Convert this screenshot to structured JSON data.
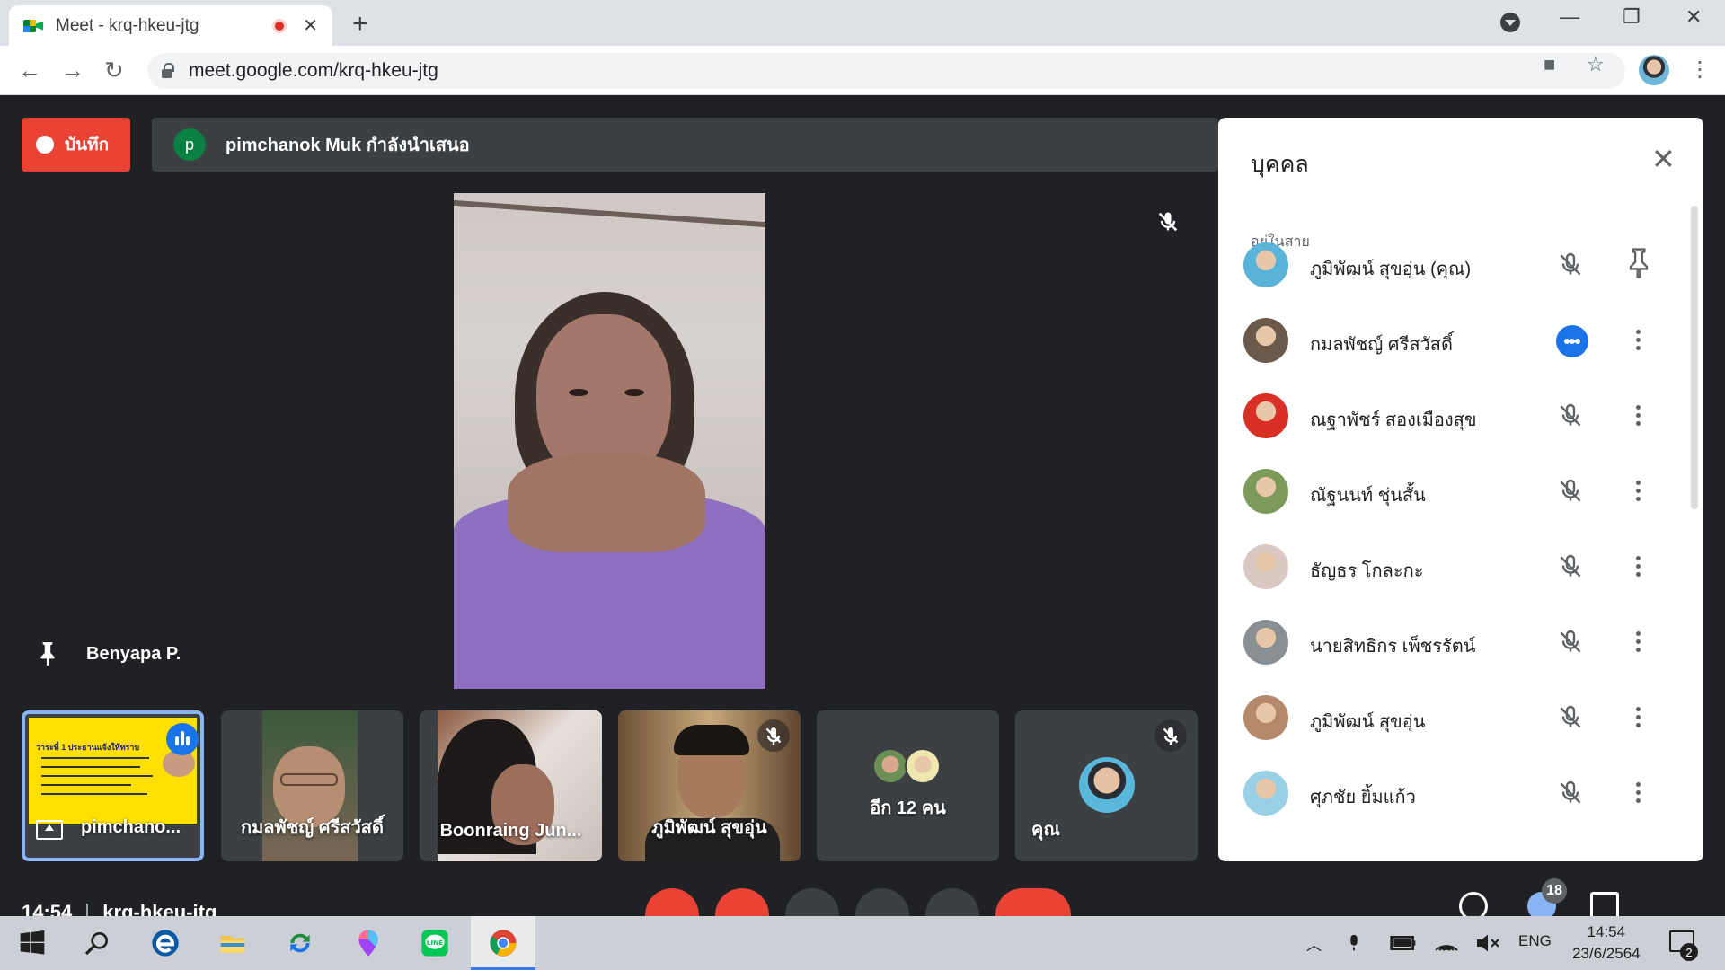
{
  "browser": {
    "tab_title": "Meet - krq-hkeu-jtg",
    "tab_close": "✕",
    "new_tab": "+",
    "url": "meet.google.com/krq-hkeu-jtg",
    "window": {
      "minimize": "—",
      "restore": "❐",
      "close": "✕"
    },
    "nav": {
      "back": "←",
      "forward": "→",
      "reload": "↻"
    },
    "omni_icons": {
      "camera": "■",
      "star": "☆"
    },
    "menu": "⋮"
  },
  "meet": {
    "record_label": "บันทึก",
    "presenter_initial": "p",
    "presenter_text": "pimchanok Muk กำลังนำเสนอ",
    "pinned_name": "Benyapa P.",
    "filmstrip": [
      {
        "name": "pimchano...",
        "kind": "presentation"
      },
      {
        "name": "กมลพัชญ์ ศรีสวัสดิ์",
        "kind": "video"
      },
      {
        "name": "Boonraing Jun...",
        "kind": "video"
      },
      {
        "name": "ภูมิพัฒน์ สุขอุ่น",
        "kind": "video"
      },
      {
        "name": "อีก 12 คน",
        "kind": "more"
      },
      {
        "name": "คุณ",
        "kind": "self"
      }
    ],
    "slide_title": "วาระที่ 1 ประธานแจ้งให้ทราบ",
    "bottom": {
      "time": "14:54",
      "code": "krq-hkeu-jtg",
      "people_count": "18"
    }
  },
  "panel": {
    "title": "บุคคล",
    "close": "✕",
    "section": "อยู่ในสาย",
    "people": [
      {
        "name": "ภูมิพัฒน์ สุขอุ่น (คุณ)",
        "status": "muted",
        "action": "pin",
        "avatar": "#5ab4d9"
      },
      {
        "name": "กมลพัชญ์ ศรีสวัสดิ์",
        "status": "speaking",
        "action": "more",
        "avatar": "#6b5a4c"
      },
      {
        "name": "ณฐาพัชร์ สองเมืองสุข",
        "status": "muted",
        "action": "more",
        "avatar": "#d93025"
      },
      {
        "name": "ณัฐนนท์ ชุ่นสั้น",
        "status": "muted",
        "action": "more",
        "avatar": "#7c9b5a"
      },
      {
        "name": "ธัญธร โกละกะ",
        "status": "muted",
        "action": "more",
        "avatar": "#d9c9c2"
      },
      {
        "name": "นายสิทธิกร เพ็ชรรัตน์",
        "status": "muted",
        "action": "more",
        "avatar": "#8a8f93"
      },
      {
        "name": "ภูมิพัฒน์ สุขอุ่น",
        "status": "muted",
        "action": "more",
        "avatar": "#b58a6b"
      },
      {
        "name": "ศุภชัย ยิ้มแก้ว",
        "status": "muted",
        "action": "more",
        "avatar": "#9ad0e6"
      }
    ]
  },
  "taskbar": {
    "language": "ENG",
    "time": "14:54",
    "date": "23/6/2564",
    "notifications": "2"
  }
}
